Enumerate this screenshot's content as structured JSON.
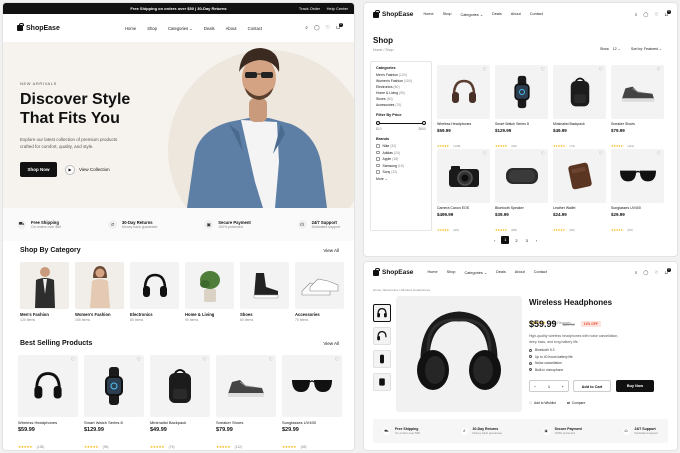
{
  "topbar": {
    "promo": "Free Shipping on orders over $50 | 30-Day Returns",
    "links": [
      "Track Order",
      "Help Center"
    ]
  },
  "brand": {
    "name": "ShopEase"
  },
  "nav": {
    "items": [
      "Home",
      "Shop",
      "Categories",
      "Deals",
      "About",
      "Contact"
    ],
    "cart_count": "0"
  },
  "hero": {
    "eyebrow": "NEW ARRIVALS",
    "title_line1": "Discover Style",
    "title_line2": "That Fits You",
    "desc_line1": "Explore our latest collection of premium products",
    "desc_line2": "crafted for comfort, quality, and style.",
    "primary_cta": "Shop Now",
    "secondary_cta": "View Collection"
  },
  "features": [
    {
      "icon": "truck-icon",
      "title": "Free Shipping",
      "sub": "On orders over $50"
    },
    {
      "icon": "return-icon",
      "title": "30-Day Returns",
      "sub": "Money back guarantee"
    },
    {
      "icon": "lock-icon",
      "title": "Secure Payment",
      "sub": "100% protected"
    },
    {
      "icon": "headset-icon",
      "title": "24/7 Support",
      "sub": "Dedicated support"
    }
  ],
  "categories_section": {
    "title": "Shop By Category",
    "view_all": "View All",
    "items": [
      {
        "name": "Men's Fashion",
        "count": "120 items"
      },
      {
        "name": "Women's Fashion",
        "count": "150 items"
      },
      {
        "name": "Electronics",
        "count": "80 items"
      },
      {
        "name": "Home & Living",
        "count": "90 items"
      },
      {
        "name": "Shoes",
        "count": "60 items"
      },
      {
        "name": "Accessories",
        "count": "70 items"
      }
    ]
  },
  "best_section": {
    "title": "Best Selling Products",
    "view_all": "View All",
    "items": [
      {
        "name": "Wireless Headphones",
        "price": "$59.99",
        "reviews": "(128)"
      },
      {
        "name": "Smart Watch Series 8",
        "price": "$129.99",
        "reviews": "(96)"
      },
      {
        "name": "Minimalist Backpack",
        "price": "$49.99",
        "reviews": "(74)"
      },
      {
        "name": "Sneaker Shoes",
        "price": "$79.99",
        "reviews": "(112)"
      },
      {
        "name": "Sunglasses UV400",
        "price": "$29.99",
        "reviews": "(65)"
      }
    ]
  },
  "shop": {
    "title": "Shop",
    "breadcrumb": [
      "Home",
      "Shop"
    ],
    "show_label": "Show",
    "show_value": "12",
    "sort_label": "Sort by:",
    "sort_value": "Featured",
    "categories_title": "Categories",
    "categories": [
      {
        "name": "Men's Fashion",
        "count": "(120)"
      },
      {
        "name": "Women's Fashion",
        "count": "(150)"
      },
      {
        "name": "Electronics",
        "count": "(80)"
      },
      {
        "name": "Home & Living",
        "count": "(90)"
      },
      {
        "name": "Shoes",
        "count": "(60)"
      },
      {
        "name": "Accessories",
        "count": "(70)"
      }
    ],
    "price_title": "Filter By Price",
    "price_min": "$10",
    "price_max": "$500",
    "brands_title": "Brands",
    "brands": [
      {
        "name": "Nike",
        "count": "(32)"
      },
      {
        "name": "Adidas",
        "count": "(24)"
      },
      {
        "name": "Apple",
        "count": "(18)"
      },
      {
        "name": "Samsung",
        "count": "(15)"
      },
      {
        "name": "Sony",
        "count": "(12)"
      }
    ],
    "more": "More",
    "products": [
      {
        "name": "Wireless Headphones",
        "price": "$59.99",
        "reviews": "(128)"
      },
      {
        "name": "Smart Watch Series 8",
        "price": "$129.99",
        "reviews": "(96)"
      },
      {
        "name": "Minimalist Backpack",
        "price": "$49.99",
        "reviews": "(74)"
      },
      {
        "name": "Sneaker Shoes",
        "price": "$79.99",
        "reviews": "(112)"
      },
      {
        "name": "Camera Canon EOS",
        "price": "$499.99",
        "reviews": "(45)"
      },
      {
        "name": "Bluetooth Speaker",
        "price": "$39.99",
        "reviews": "(88)"
      },
      {
        "name": "Leather Wallet",
        "price": "$24.99",
        "reviews": "(60)"
      },
      {
        "name": "Sunglasses UV400",
        "price": "$29.99",
        "reviews": "(65)"
      }
    ],
    "pages": [
      "1",
      "2",
      "3"
    ]
  },
  "detail": {
    "breadcrumb": [
      "Home",
      "Electronics",
      "Wireless Headphones"
    ],
    "title": "Wireless Headphones",
    "reviews": "(128 Reviews)",
    "price": "$59.99",
    "old_price": "$69.99",
    "discount": "14% OFF",
    "desc_line1": "High-quality wireless headphones with noise cancellation,",
    "desc_line2": "deep bass, and long battery life.",
    "features": [
      "Bluetooth 5.3",
      "Up to 40 hours battery life",
      "Noise cancellation",
      "Built-in microphone"
    ],
    "qty": "1",
    "add_to_cart": "Add to Cart",
    "buy_now": "Buy Now",
    "wishlist": "Add to Wishlist",
    "compare": "Compare"
  },
  "colors": {
    "accent": "#111111",
    "star": "#f4b400",
    "sale": "#e8462b",
    "hero_bg": "#f6f3ee"
  }
}
